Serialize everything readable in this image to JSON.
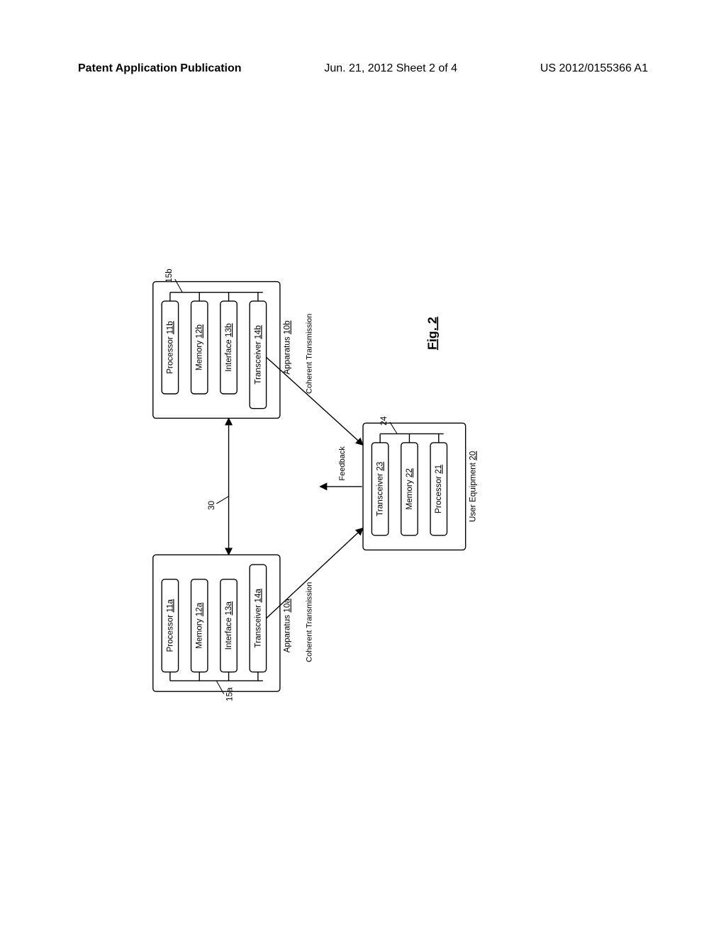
{
  "header": {
    "left": "Patent Application Publication",
    "center": "Jun. 21, 2012  Sheet 2 of 4",
    "right": "US 2012/0155366 A1"
  },
  "apparatus_a": {
    "processor": "Processor",
    "processor_ref": "11a",
    "memory": "Memory",
    "memory_ref": "12a",
    "interface": "Interface",
    "interface_ref": "13a",
    "transceiver": "Transceiver",
    "transceiver_ref": "14a",
    "title": "Apparatus",
    "title_ref": "10a",
    "bus_ref": "15a"
  },
  "apparatus_b": {
    "processor": "Processor",
    "processor_ref": "11b",
    "memory": "Memory",
    "memory_ref": "12b",
    "interface": "Interface",
    "interface_ref": "13b",
    "transceiver": "Transceiver",
    "transceiver_ref": "14b",
    "title": "Apparatus",
    "title_ref": "10b",
    "bus_ref": "15b"
  },
  "user_equipment": {
    "transceiver": "Transceiver",
    "transceiver_ref": "23",
    "memory": "Memory",
    "memory_ref": "22",
    "processor": "Processor",
    "processor_ref": "21",
    "title": "User Equipment",
    "title_ref": "20",
    "bus_ref": "24"
  },
  "labels": {
    "coherent_a": "Coherent Transmission",
    "coherent_b": "Coherent Transmission",
    "feedback": "Feedback",
    "link_ref": "30",
    "figure": "Fig. 2"
  }
}
